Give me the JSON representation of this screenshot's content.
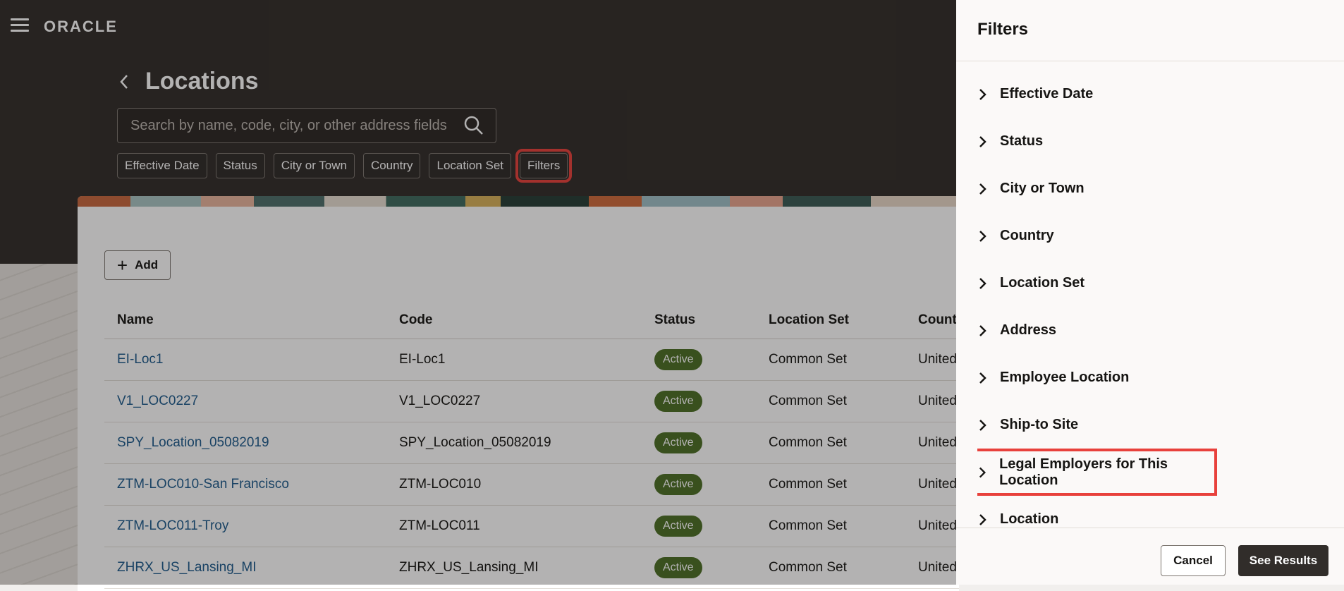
{
  "app": {
    "logo_text": "ORACLE"
  },
  "page": {
    "title": "Locations"
  },
  "search": {
    "placeholder": "Search by name, code, city, or other address fields",
    "value": ""
  },
  "chips": [
    {
      "label": "Effective Date"
    },
    {
      "label": "Status"
    },
    {
      "label": "City or Town"
    },
    {
      "label": "Country"
    },
    {
      "label": "Location Set"
    },
    {
      "label": "Filters"
    }
  ],
  "toolbar": {
    "add_label": "Add"
  },
  "table": {
    "columns": [
      "Name",
      "Code",
      "Status",
      "Location Set",
      "Count"
    ],
    "rows": [
      {
        "name": "EI-Loc1",
        "code": "EI-Loc1",
        "status": "Active",
        "location_set": "Common Set",
        "country": "United"
      },
      {
        "name": "V1_LOC0227",
        "code": "V1_LOC0227",
        "status": "Active",
        "location_set": "Common Set",
        "country": "United"
      },
      {
        "name": "SPY_Location_05082019",
        "code": "SPY_Location_05082019",
        "status": "Active",
        "location_set": "Common Set",
        "country": "United"
      },
      {
        "name": "ZTM-LOC010-San Francisco",
        "code": "ZTM-LOC010",
        "status": "Active",
        "location_set": "Common Set",
        "country": "United"
      },
      {
        "name": "ZTM-LOC011-Troy",
        "code": "ZTM-LOC011",
        "status": "Active",
        "location_set": "Common Set",
        "country": "United"
      },
      {
        "name": "ZHRX_US_Lansing_MI",
        "code": "ZHRX_US_Lansing_MI",
        "status": "Active",
        "location_set": "Common Set",
        "country": "United"
      }
    ]
  },
  "filters_panel": {
    "title": "Filters",
    "items": [
      {
        "label": "Effective Date"
      },
      {
        "label": "Status"
      },
      {
        "label": "City or Town"
      },
      {
        "label": "Country"
      },
      {
        "label": "Location Set"
      },
      {
        "label": "Address"
      },
      {
        "label": "Employee Location"
      },
      {
        "label": "Ship-to Site"
      },
      {
        "label": "Legal Employers for This Location"
      },
      {
        "label": "Location"
      }
    ],
    "cancel_label": "Cancel",
    "results_label": "See Results"
  },
  "colors": {
    "accent_dark": "#312d2a",
    "active_badge": "#4c6f25",
    "link": "#1d5b8c",
    "highlight": "#e8413c"
  }
}
